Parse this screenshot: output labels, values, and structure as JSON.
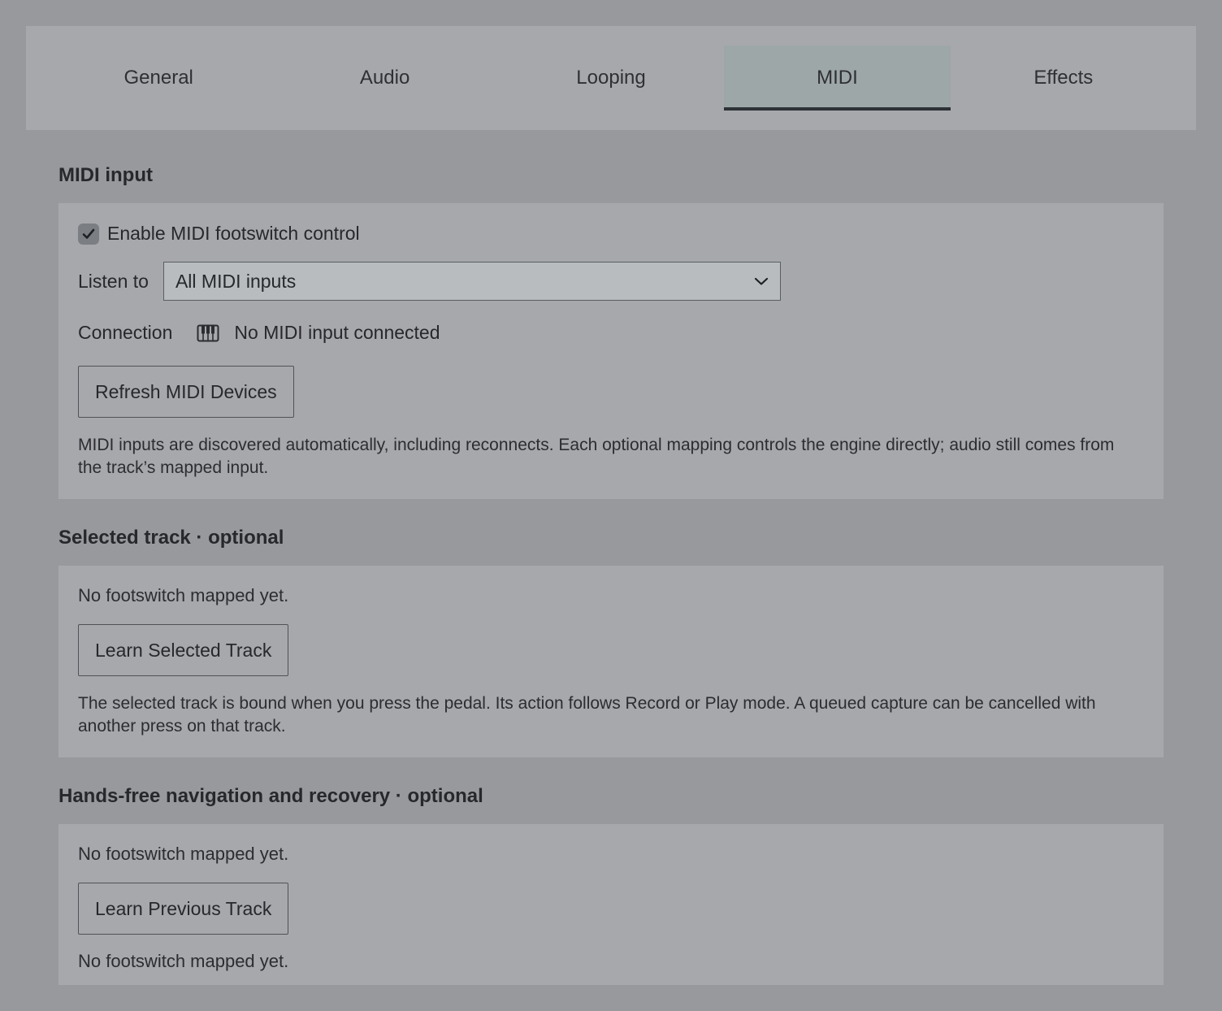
{
  "tabs": [
    {
      "label": "General"
    },
    {
      "label": "Audio"
    },
    {
      "label": "Looping"
    },
    {
      "label": "MIDI"
    },
    {
      "label": "Effects"
    }
  ],
  "active_tab": "MIDI",
  "midi_input": {
    "title": "MIDI input",
    "enable_label": "Enable MIDI footswitch control",
    "enable_checked": true,
    "listen_label": "Listen to",
    "listen_value": "All MIDI inputs",
    "connection_label": "Connection",
    "connection_icon": "piano-keys-icon",
    "connection_status": "No MIDI input connected",
    "refresh_button": "Refresh MIDI Devices",
    "description": "MIDI inputs are discovered automatically, including reconnects. Each optional mapping controls the engine directly; audio still comes from the track’s mapped input."
  },
  "selected_track": {
    "title": "Selected track · optional",
    "status": "No footswitch mapped yet.",
    "learn_button": "Learn Selected Track",
    "description": "The selected track is bound when you press the pedal. Its action follows Record or Play mode. A queued capture can be cancelled with another press on that track."
  },
  "hands_free": {
    "title": "Hands-free navigation and recovery · optional",
    "status_1": "No footswitch mapped yet.",
    "learn_button": "Learn Previous Track",
    "status_2": "No footswitch mapped yet."
  }
}
